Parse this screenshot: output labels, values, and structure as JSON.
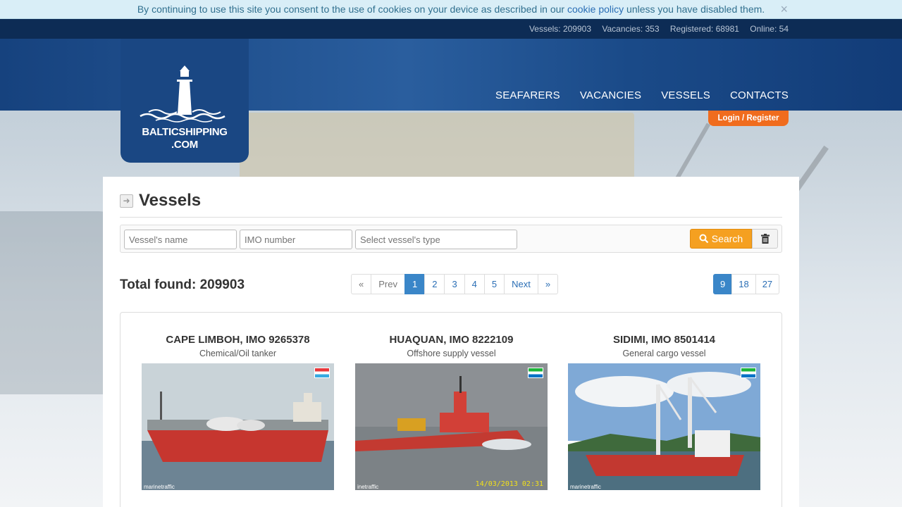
{
  "cookie": {
    "text_before": "By continuing to use this site you consent to the use of cookies on your device as described in our ",
    "link": "cookie policy",
    "text_after": " unless you have disabled them.",
    "close": "×"
  },
  "stats": {
    "vessels": "Vessels: 209903",
    "vacancies": "Vacancies: 353",
    "registered": "Registered: 68981",
    "online": "Online: 54"
  },
  "logo": {
    "line1": "BALTICSHIPPING",
    "line2": ".COM"
  },
  "nav": {
    "seafarers": "SEAFARERS",
    "vacancies": "VACANCIES",
    "vessels": "VESSELS",
    "contacts": "CONTACTS"
  },
  "auth": {
    "login": "Login",
    "sep": "/",
    "register": "Register"
  },
  "page": {
    "title": "Vessels"
  },
  "filters": {
    "name_placeholder": "Vessel's name",
    "imo_placeholder": "IMO number",
    "type_placeholder": "Select vessel's type",
    "search_label": "Search"
  },
  "results": {
    "total_label": "Total found: 209903"
  },
  "pagination": {
    "first": "«",
    "prev": "Prev",
    "pages": [
      "1",
      "2",
      "3",
      "4",
      "5"
    ],
    "next": "Next",
    "last": "»",
    "current": "1"
  },
  "per_page": {
    "options": [
      "9",
      "18",
      "27"
    ],
    "current": "9"
  },
  "vessels": [
    {
      "title": "CAPE LIMBOH, IMO 9265378",
      "type": "Chemical/Oil tanker",
      "watermark": "marinetraffic"
    },
    {
      "title": "HUAQUAN, IMO 8222109",
      "type": "Offshore supply vessel",
      "watermark": "inetraffic",
      "caption": "14/03/2013 02:31"
    },
    {
      "title": "SIDIMI, IMO 8501414",
      "type": "General cargo vessel",
      "watermark": "marinetraffic"
    }
  ],
  "colors": {
    "accent": "#f06c1e",
    "header": "#16427e",
    "link": "#2a6eb5",
    "active": "#3a86c8"
  }
}
